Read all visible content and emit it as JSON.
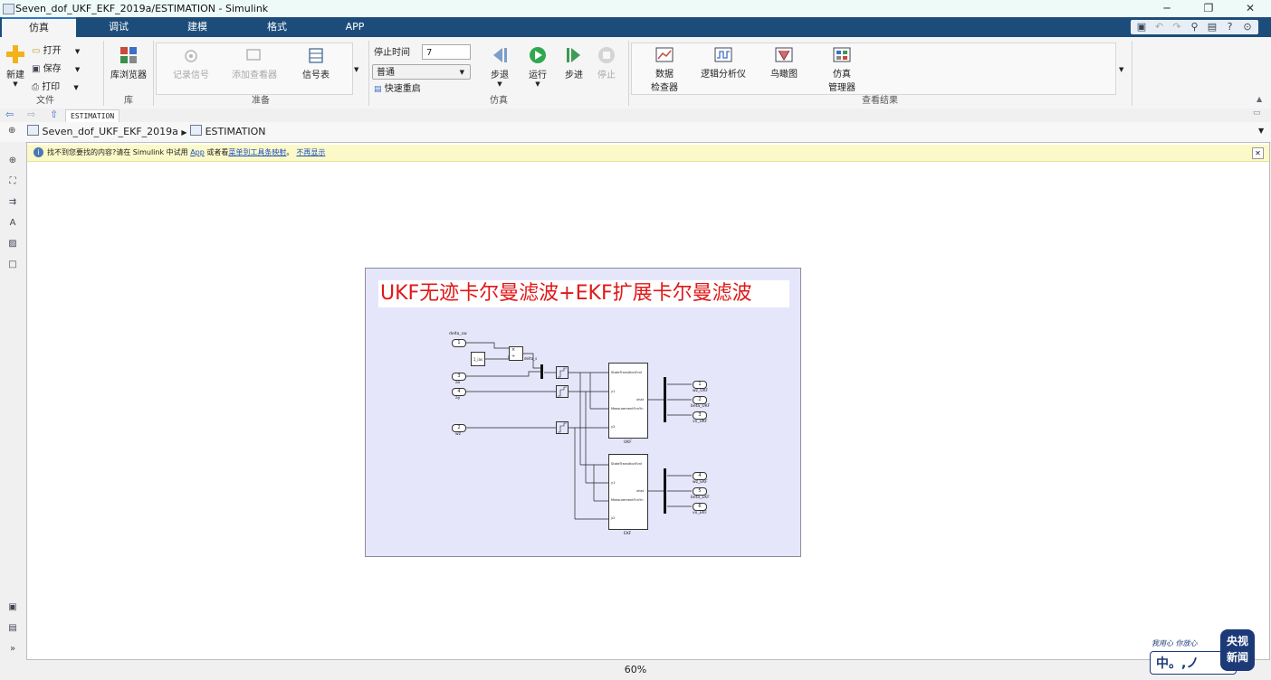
{
  "window": {
    "title": "Seven_dof_UKF_EKF_2019a/ESTIMATION - Simulink",
    "minimize": "─",
    "maximize": "❐",
    "close": "✕"
  },
  "tabs": [
    {
      "label": "仿真",
      "active": true
    },
    {
      "label": "调试"
    },
    {
      "label": "建模"
    },
    {
      "label": "格式"
    },
    {
      "label": "APP"
    }
  ],
  "quick_access": [
    "save-icon",
    "undo-icon",
    "redo-icon",
    "search-icon",
    "zoom-icon",
    "help-icon",
    "collapse-icon"
  ],
  "ribbon": {
    "file": {
      "new_label": "新建",
      "open_label": "打开",
      "save_label": "保存",
      "print_label": "打印",
      "group_label": "文件"
    },
    "library": {
      "browser_label": "库浏览器",
      "group_label": "库"
    },
    "prepare": {
      "log_signals": "记录信号",
      "add_viewer": "添加查看器",
      "signal_table": "信号表",
      "group_label": "准备"
    },
    "simulate": {
      "stop_time_label": "停止时间",
      "stop_time_value": "7",
      "mode_value": "普通",
      "fast_restart": "快速重启",
      "step_back": "步退",
      "run": "运行",
      "step_forward": "步进",
      "stop": "停止",
      "group_label": "仿真"
    },
    "review": {
      "data_inspector_1": "数据",
      "data_inspector_2": "检查器",
      "logic_analyzer": "逻辑分析仪",
      "birdseye": "鸟瞰图",
      "sim_manager_1": "仿真",
      "sim_manager_2": "管理器",
      "group_label": "查看结果"
    }
  },
  "nav": {
    "tab_label": "ESTIMATION"
  },
  "breadcrumb": {
    "root": "Seven_dof_UKF_EKF_2019a",
    "current": "ESTIMATION"
  },
  "infobar": {
    "text_1": "找不到您要找的内容?请在 Simulink 中试用 ",
    "link_app": "App",
    "text_2": " 或者看",
    "link_map": "菜单到工具条映射",
    "text_3": "。",
    "link_dismiss": "不再显示"
  },
  "model": {
    "title": "UKF无迹卡尔曼滤波+EKF扩展卡尔曼滤波",
    "inports": [
      {
        "num": "1",
        "label": "delta_sw"
      },
      {
        "num": "3",
        "label": "ax"
      },
      {
        "num": "4",
        "label": "ay"
      },
      {
        "num": "2",
        "label": "wz"
      }
    ],
    "gain_label": "1_ias",
    "mux_label": "delta_s",
    "ukf": {
      "block_label": "UKF",
      "port_state": "StateTransitionFcnI",
      "port_y1": "y1",
      "port_meas": "MeasurementFcnYn",
      "port_y2": "y2",
      "port_xhat": "xhat"
    },
    "ekf": {
      "block_label": "EKF",
      "port_state": "StateTransitionFcnI",
      "port_y1": "y1",
      "port_meas": "MeasurementFcnYn",
      "port_y2": "y2",
      "port_xhat": "xhat"
    },
    "outports_ukf": [
      {
        "num": "1",
        "label": "wz_UKF"
      },
      {
        "num": "2",
        "label": "beta_UKF"
      },
      {
        "num": "3",
        "label": "vx_UKF"
      }
    ],
    "outports_ekf": [
      {
        "num": "4",
        "label": "wz_EKF"
      },
      {
        "num": "5",
        "label": "beta_EKF"
      },
      {
        "num": "6",
        "label": "vx_EKF"
      }
    ]
  },
  "status": {
    "zoom": "60%"
  },
  "watermark": {
    "slogan": "我用心 你放心",
    "cctv_1": "央视",
    "cctv_2": "新闻",
    "mark": "中。,ノ"
  }
}
